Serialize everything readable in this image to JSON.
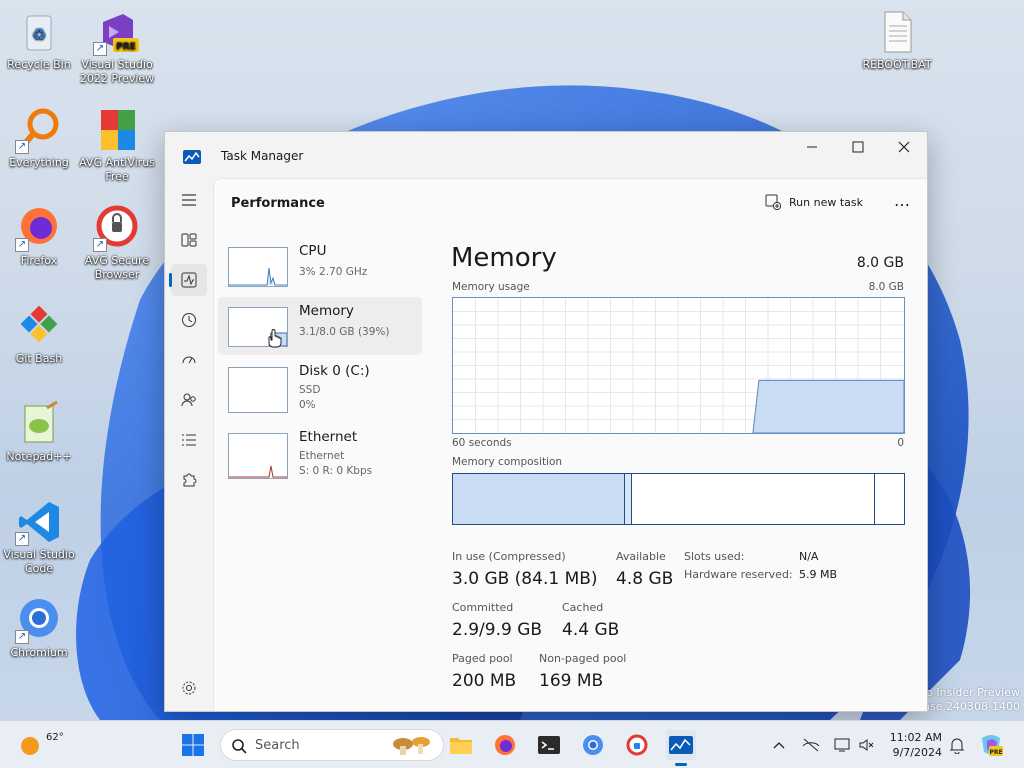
{
  "desktop": {
    "icons": [
      {
        "label": "Recycle Bin"
      },
      {
        "label": "Visual Studio 2022 Preview"
      },
      {
        "label": "Everything"
      },
      {
        "label": "AVG AntiVirus Free"
      },
      {
        "label": "Firefox"
      },
      {
        "label": "AVG Secure Browser"
      },
      {
        "label": "Git Bash"
      },
      {
        "label": "Notepad++"
      },
      {
        "label": "Visual Studio Code"
      },
      {
        "label": "Chromium"
      },
      {
        "label": "REBOOT.BAT"
      }
    ],
    "pre_badge": "PRE",
    "watermark_line1": "ro Insider Preview",
    "watermark_line2": "ease.240308-1400"
  },
  "window": {
    "title": "Task Manager",
    "page_title": "Performance",
    "run_new_task": "Run new task",
    "more": "…"
  },
  "resources": [
    {
      "name": "CPU",
      "sub1": "3% 2.70 GHz",
      "sub2": ""
    },
    {
      "name": "Memory",
      "sub1": "3.1/8.0 GB (39%)",
      "sub2": ""
    },
    {
      "name": "Disk 0 (C:)",
      "sub1": "SSD",
      "sub2": "0%"
    },
    {
      "name": "Ethernet",
      "sub1": "Ethernet",
      "sub2": "S: 0 R: 0 Kbps"
    }
  ],
  "memory": {
    "title": "Memory",
    "total": "8.0 GB",
    "usage_label": "Memory usage",
    "usage_max": "8.0 GB",
    "x_left": "60 seconds",
    "x_right": "0",
    "composition_label": "Memory composition",
    "usage_fraction": 0.39,
    "stats": {
      "in_use_label": "In use (Compressed)",
      "in_use_value": "3.0 GB (84.1 MB)",
      "available_label": "Available",
      "available_value": "4.8 GB",
      "committed_label": "Committed",
      "committed_value": "2.9/9.9 GB",
      "cached_label": "Cached",
      "cached_value": "4.4 GB",
      "paged_label": "Paged pool",
      "paged_value": "200 MB",
      "nonpaged_label": "Non-paged pool",
      "nonpaged_value": "169 MB",
      "slots_label": "Slots used:",
      "slots_value": "N/A",
      "hw_label": "Hardware reserved:",
      "hw_value": "5.9 MB"
    }
  },
  "taskbar": {
    "weather": "62°",
    "search_placeholder": "Search",
    "time": "11:02 AM",
    "date": "9/7/2024"
  },
  "colors": {
    "accent": "#0067c0",
    "memory_line": "#6b8fbf",
    "memory_fill": "#c9dcf3"
  }
}
